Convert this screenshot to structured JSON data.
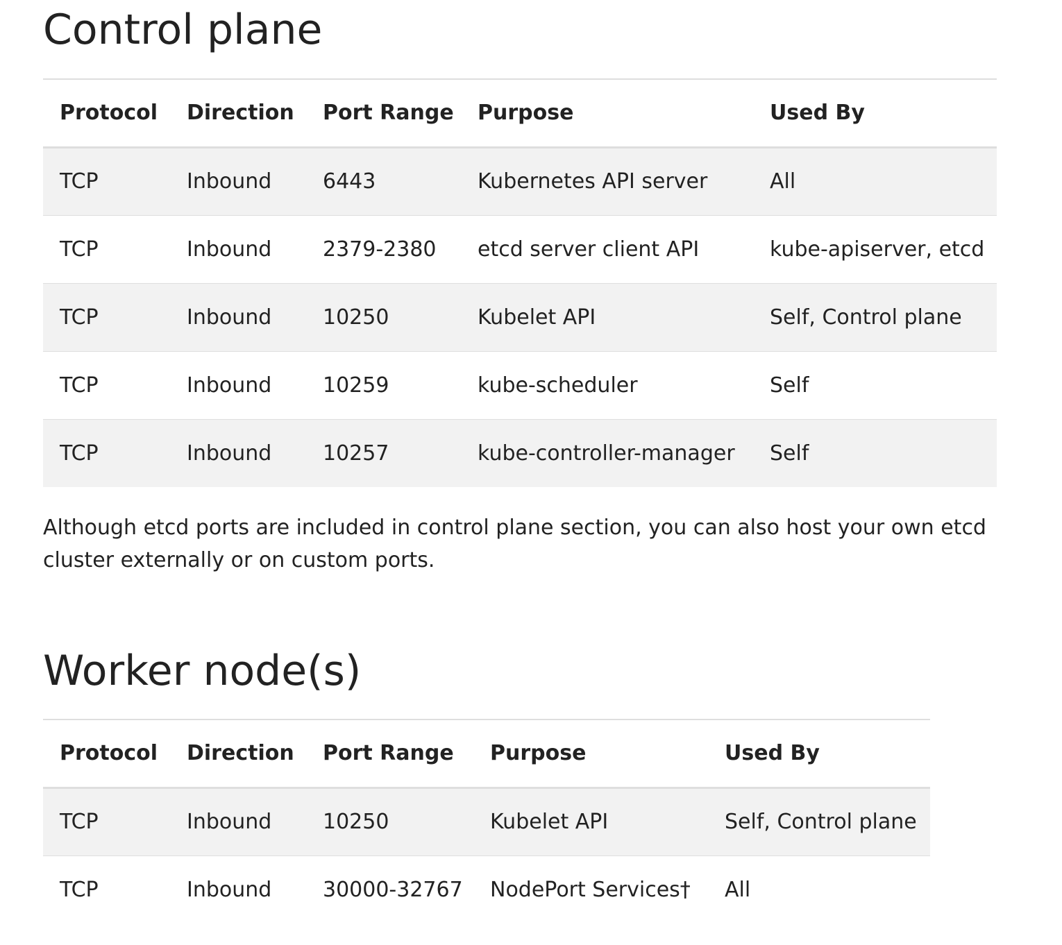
{
  "control_plane": {
    "title": "Control plane",
    "headers": [
      "Protocol",
      "Direction",
      "Port Range",
      "Purpose",
      "Used By"
    ],
    "rows": [
      [
        "TCP",
        "Inbound",
        "6443",
        "Kubernetes API server",
        "All"
      ],
      [
        "TCP",
        "Inbound",
        "2379-2380",
        "etcd server client API",
        "kube-apiserver, etcd"
      ],
      [
        "TCP",
        "Inbound",
        "10250",
        "Kubelet API",
        "Self, Control plane"
      ],
      [
        "TCP",
        "Inbound",
        "10259",
        "kube-scheduler",
        "Self"
      ],
      [
        "TCP",
        "Inbound",
        "10257",
        "kube-controller-manager",
        "Self"
      ]
    ],
    "note": "Although etcd ports are included in control plane section, you can also host your own etcd cluster externally or on custom ports."
  },
  "worker_nodes": {
    "title": "Worker node(s)",
    "headers": [
      "Protocol",
      "Direction",
      "Port Range",
      "Purpose",
      "Used By"
    ],
    "rows": [
      [
        "TCP",
        "Inbound",
        "10250",
        "Kubelet API",
        "Self, Control plane"
      ],
      [
        "TCP",
        "Inbound",
        "30000-32767",
        "NodePort Services†",
        "All"
      ]
    ]
  },
  "colors": {
    "text": "#222222",
    "row_stripe": "#f2f2f2",
    "border": "#dedede"
  }
}
